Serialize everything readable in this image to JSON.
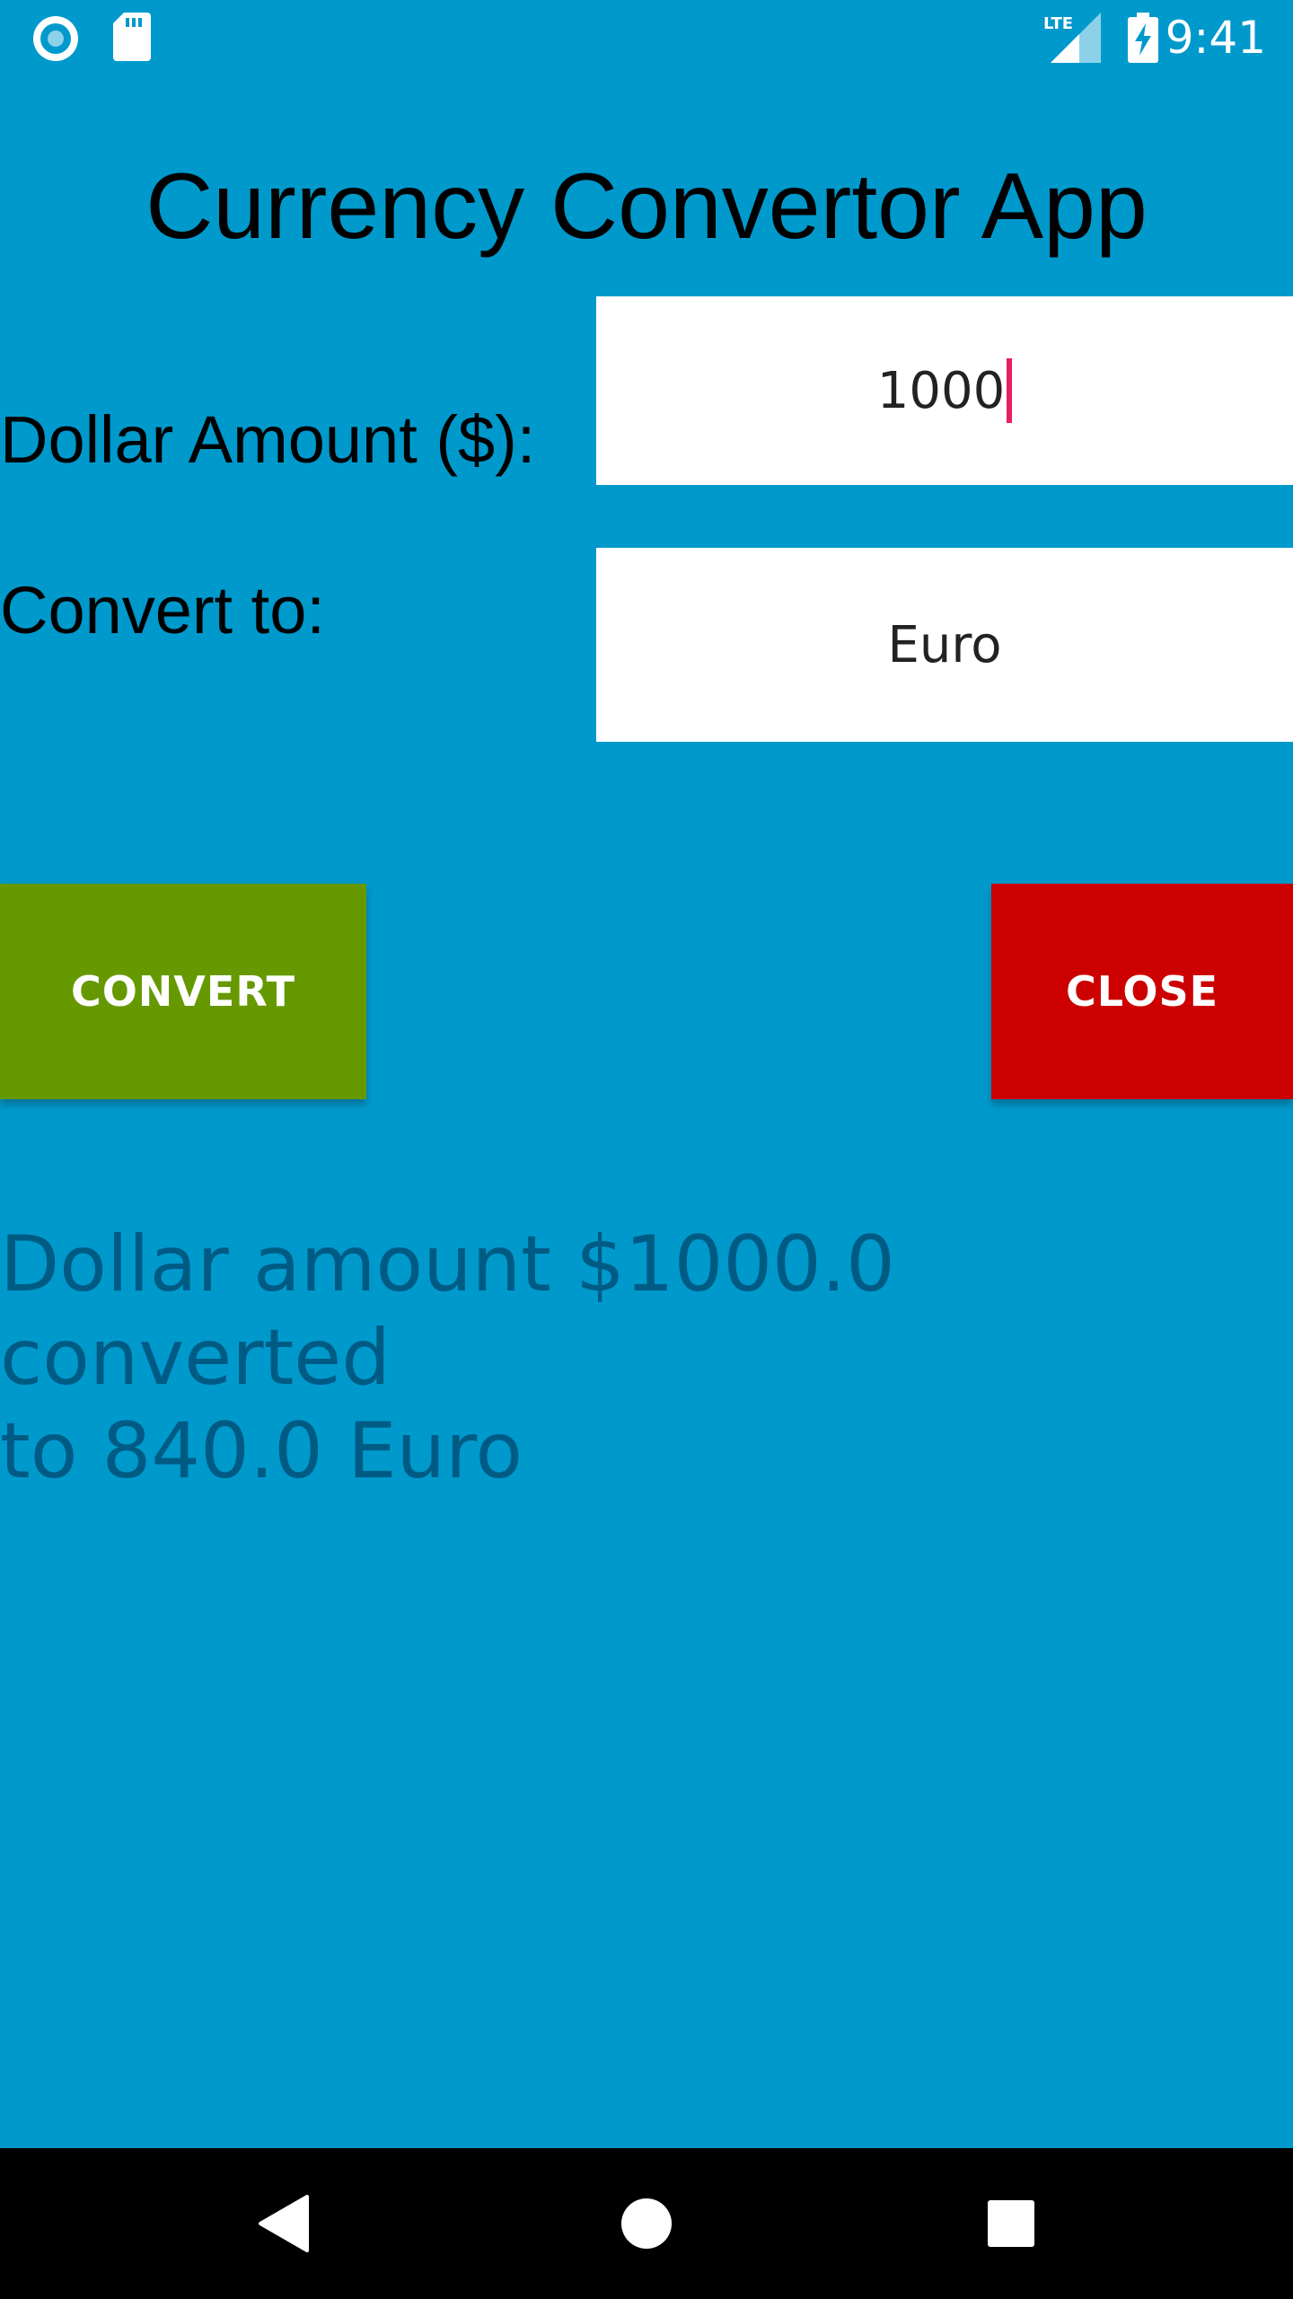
{
  "status_bar": {
    "time": "9:41",
    "network": "LTE",
    "icons": [
      "sync-icon",
      "sd-card-icon",
      "lte-signal-icon",
      "battery-charging-icon"
    ]
  },
  "app": {
    "title": "Currency Convertor App"
  },
  "form": {
    "dollar_label": "Dollar Amount ($):",
    "dollar_value": "1000",
    "convert_label": "Convert to:",
    "currency_selected": "Euro"
  },
  "buttons": {
    "convert_label": "CONVERT",
    "close_label": "CLOSE"
  },
  "result": {
    "line1": "Dollar amount $1000.0 converted",
    "line2": "to 840.0 Euro"
  },
  "nav": {
    "icons": [
      "back-icon",
      "home-icon",
      "recents-icon"
    ]
  },
  "colors": {
    "background": "#0099CC",
    "convert_button": "#669900",
    "close_button": "#CC0000",
    "result_text": "#005B84",
    "caret": "#E91E63"
  }
}
